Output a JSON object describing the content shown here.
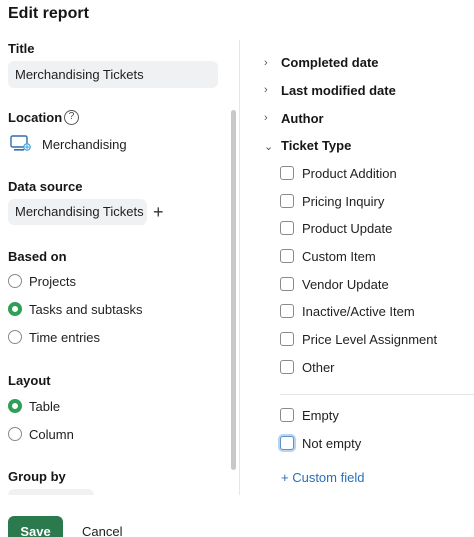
{
  "dialog": {
    "title": "Edit report"
  },
  "left": {
    "title_label": "Title",
    "title_value": "Merchandising Tickets",
    "location_label": "Location",
    "location_help": "?",
    "location_value": "Merchandising",
    "datasource_label": "Data source",
    "datasource_value": "Merchandising Tickets",
    "datasource_add": "+",
    "based_on_label": "Based on",
    "based_on_options": [
      {
        "label": "Projects",
        "checked": false
      },
      {
        "label": "Tasks and subtasks",
        "checked": true
      },
      {
        "label": "Time entries",
        "checked": false
      }
    ],
    "layout_label": "Layout",
    "layout_options": [
      {
        "label": "Table",
        "checked": true
      },
      {
        "label": "Column",
        "checked": false
      }
    ],
    "group_by_label": "Group by"
  },
  "right": {
    "collapsed_sections": [
      {
        "label": "Completed date",
        "icon": "chevron-right-icon"
      },
      {
        "label": "Last modified date",
        "icon": "chevron-right-icon"
      },
      {
        "label": "Author",
        "icon": "chevron-right-icon"
      }
    ],
    "expanded_section": {
      "label": "Ticket Type",
      "icon": "chevron-down-icon"
    },
    "ticket_types": [
      {
        "label": "Product Addition",
        "checked": false
      },
      {
        "label": "Pricing Inquiry",
        "checked": false
      },
      {
        "label": "Product Update",
        "checked": false
      },
      {
        "label": "Custom Item",
        "checked": false
      },
      {
        "label": "Vendor Update",
        "checked": false
      },
      {
        "label": "Inactive/Active Item",
        "checked": false
      },
      {
        "label": "Price Level Assignment",
        "checked": false
      },
      {
        "label": "Other",
        "checked": false
      }
    ],
    "empty_options": [
      {
        "label": "Empty",
        "checked": false
      },
      {
        "label": "Not empty",
        "checked": false,
        "focused": true
      }
    ],
    "custom_field_link": "+ Custom field"
  },
  "footer": {
    "save_label": "Save",
    "cancel_label": "Cancel"
  },
  "colors": {
    "accent_green": "#2b7a4d",
    "radio_green": "#2f9e57",
    "link_blue": "#2a6fb7",
    "field_bg": "#f0f1f2"
  }
}
